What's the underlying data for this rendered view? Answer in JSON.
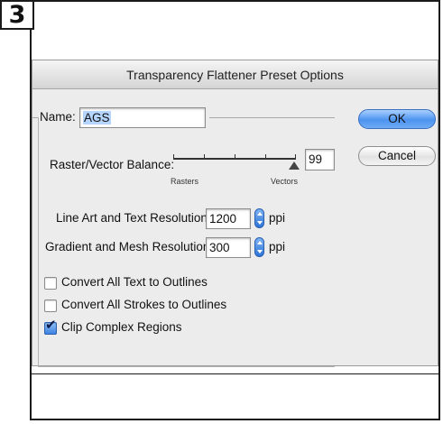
{
  "step": {
    "number": "3"
  },
  "dialog": {
    "title": "Transparency Flattener Preset Options",
    "name_label": "Name:",
    "name_value": "AGS",
    "balance": {
      "label": "Raster/Vector Balance:",
      "value": "99",
      "left_caption": "Rasters",
      "right_caption": "Vectors",
      "level_percent": 99
    },
    "line_art": {
      "label": "Line Art and Text Resolution:",
      "value": "1200",
      "unit": "ppi"
    },
    "gradient": {
      "label": "Gradient and Mesh Resolution:",
      "value": "300",
      "unit": "ppi"
    },
    "checkboxes": [
      {
        "label": "Convert All Text to Outlines",
        "checked": false
      },
      {
        "label": "Convert All Strokes to Outlines",
        "checked": false
      },
      {
        "label": "Clip Complex Regions",
        "checked": true
      }
    ],
    "buttons": {
      "ok": "OK",
      "cancel": "Cancel"
    }
  },
  "colors": {
    "ok_button": "#4d94f0",
    "selection": "#b5d5ff",
    "checked_box": "#3d82e0"
  }
}
